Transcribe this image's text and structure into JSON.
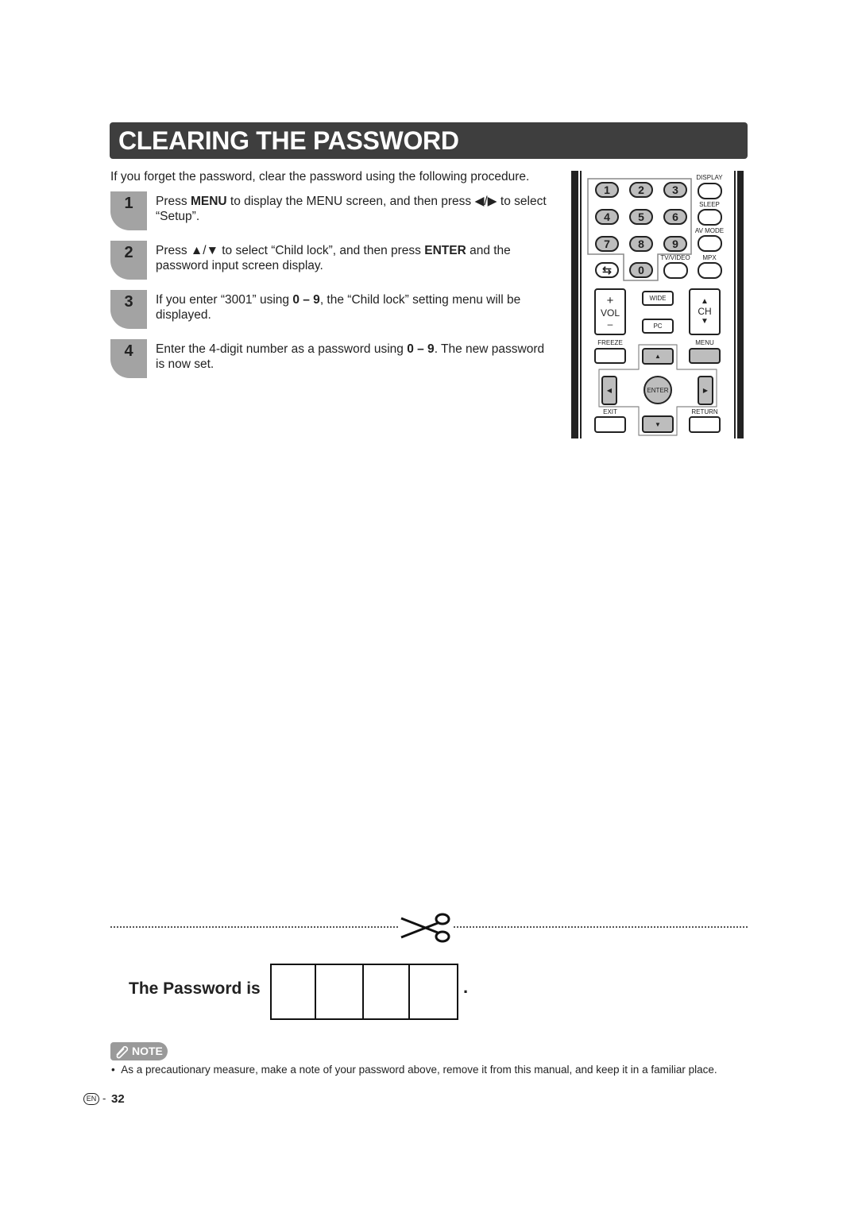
{
  "title": "CLEARING THE PASSWORD",
  "intro": "If you forget the password, clear the password using the following procedure.",
  "steps": [
    {
      "num": "1",
      "pre": "Press ",
      "b1": "MENU",
      "mid": " to display the MENU screen, and then press ◀/▶ to select “Setup”.",
      "b2": "",
      "post": ""
    },
    {
      "num": "2",
      "pre": "Press ▲/▼ to select “Child lock”, and then press ",
      "b1": "ENTER",
      "mid": " and the password input screen display.",
      "b2": "",
      "post": ""
    },
    {
      "num": "3",
      "pre": "If you enter “3001” using ",
      "b1": "0 – 9",
      "mid": ", the “Child lock” setting menu will be displayed.",
      "b2": "",
      "post": ""
    },
    {
      "num": "4",
      "pre": "Enter the 4-digit number as a password using ",
      "b1": "0 – 9",
      "mid": ". The new password is now set.",
      "b2": "",
      "post": ""
    }
  ],
  "remote": {
    "numbers": [
      "1",
      "2",
      "3",
      "4",
      "5",
      "6",
      "7",
      "8",
      "9",
      "0"
    ],
    "labels": {
      "display": "DISPLAY",
      "sleep": "SLEEP",
      "av_mode": "AV MODE",
      "tv_video": "TV/VIDEO",
      "mpx": "MPX",
      "wide": "WIDE",
      "pc": "PC",
      "vol": "VOL",
      "vol_plus": "+",
      "vol_minus": "–",
      "ch": "CH",
      "freeze": "FREEZE",
      "menu": "MENU",
      "enter": "ENTER",
      "exit": "EXIT",
      "return": "RETURN"
    },
    "icons": {
      "flashback": "⇆",
      "up": "▲",
      "down": "▼",
      "left": "◀",
      "right": "▶"
    }
  },
  "password": {
    "label": "The Password is",
    "period": "."
  },
  "note": {
    "badge": "NOTE",
    "text": "As a precautionary measure, make a note of your password above, remove it from this manual, and keep it in a familiar place."
  },
  "footer": {
    "lang": "EN",
    "page": "32"
  },
  "colors": {
    "title_bg": "#3e3e3e",
    "badge": "#a3a3a3",
    "button_gray": "#bdbdbd"
  }
}
